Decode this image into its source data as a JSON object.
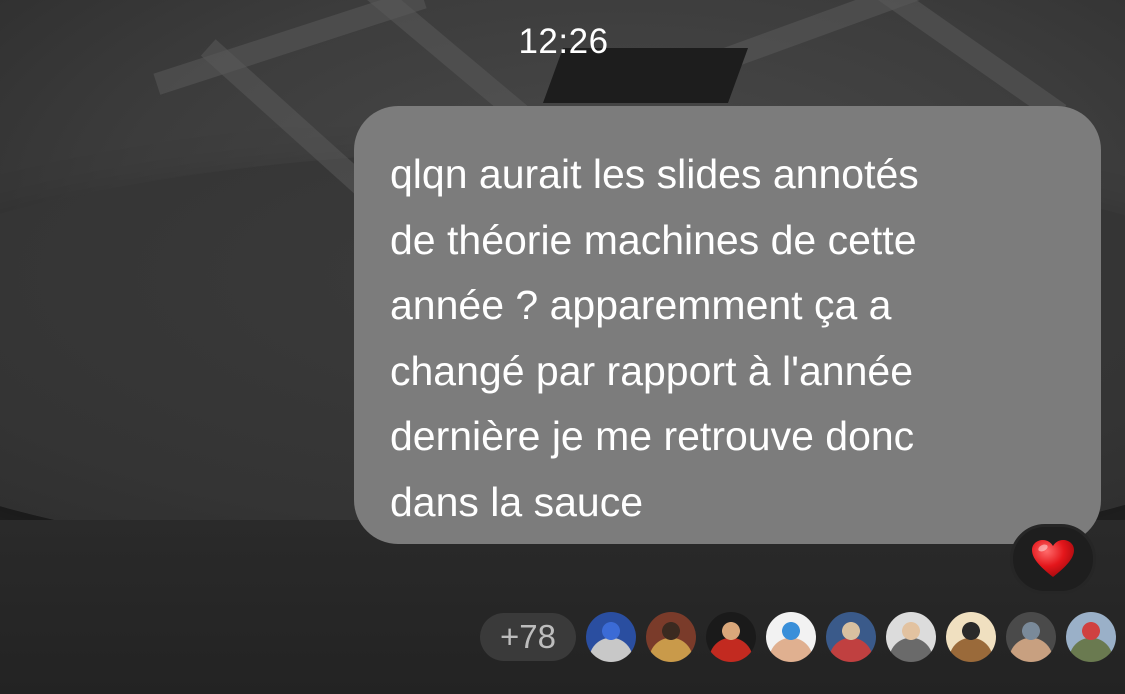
{
  "conversation": {
    "timestamp": "12:26"
  },
  "message": {
    "text": "qlqn aurait les slides annotés\nde théorie machines de cette\nannée ? apparemment ça a\nchangé par rapport à l'année\ndernière je me retrouve donc\ndans la sauce",
    "bubble_color": "#7c7c7c",
    "reaction": "❤️",
    "reaction_icon": "red-heart-icon"
  },
  "seen_by": {
    "more_count": "+78",
    "avatars": [
      {
        "name": "avatar-runner",
        "colors": [
          "#2a4ea0",
          "#c8c8c8",
          "#3b6bd6"
        ]
      },
      {
        "name": "avatar-costume",
        "colors": [
          "#7a3b2a",
          "#c99a4a",
          "#3b2a20"
        ]
      },
      {
        "name": "avatar-red-cap",
        "colors": [
          "#1a1a1a",
          "#c22a20",
          "#d9a77a"
        ]
      },
      {
        "name": "avatar-cartoon-penguin",
        "colors": [
          "#f2f2f2",
          "#e0b090",
          "#3a8fd9"
        ]
      },
      {
        "name": "avatar-group-photo",
        "colors": [
          "#3a5a8a",
          "#c04040",
          "#d8c0a0"
        ]
      },
      {
        "name": "avatar-kid-white",
        "colors": [
          "#dcdcdc",
          "#6a6a6a",
          "#e2c2a0"
        ]
      },
      {
        "name": "avatar-manga-face",
        "colors": [
          "#f0e0c0",
          "#9a6a3a",
          "#2a2a2a"
        ]
      },
      {
        "name": "avatar-young-man",
        "colors": [
          "#4a4a4a",
          "#c8a080",
          "#7a8a9a"
        ]
      },
      {
        "name": "avatar-street",
        "colors": [
          "#9ab0c8",
          "#6a7a50",
          "#d04040"
        ]
      }
    ]
  }
}
